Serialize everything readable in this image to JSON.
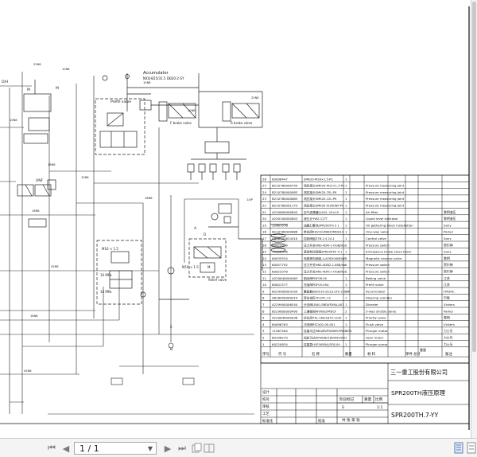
{
  "diagram": {
    "labels": {
      "accumulator": "Accumulator",
      "accumulator_code": "NXQ-B25/31.5",
      "valve_code": "DB20-2 GY",
      "prefill_valve": "Prefill valve",
      "relief_valve": "Relief valve",
      "m16": "M16 × 1.5",
      "m16b": "M16 × 1.5",
      "pressure_a": "10 MPa",
      "pressure_b": "10 MPa",
      "marker_e": "E",
      "marker_b": "B",
      "marker_a": "A"
    },
    "parts_table": {
      "rows": [
        {
          "no": "26",
          "code": "60096447",
          "spec": "SMK20-M16×1.5-PC",
          "qty": "1",
          "name": "",
          "maker": ""
        },
        {
          "no": "25",
          "code": "B210780000749",
          "spec": "测压接头SMK20-M12×1.5-PC",
          "qty": "1",
          "name": "Pressure measuring joint",
          "maker": ""
        },
        {
          "no": "24",
          "code": "B210780000083",
          "spec": "测压接头SMK20-7SL-PK",
          "qty": "1",
          "name": "Pressure measuring joint",
          "maker": ""
        },
        {
          "no": "23",
          "code": "B210780000885",
          "spec": "测压接头SMK20-12L-PK",
          "qty": "1",
          "name": "Pressure measuring joint",
          "maker": ""
        },
        {
          "no": "22",
          "code": "B210780001175",
          "spec": "测压接头SMK20-9/16UNF-PC",
          "qty": "1",
          "name": "Pressure measuring joint",
          "maker": ""
        },
        {
          "no": "21",
          "code": "A220800000845",
          "spec": "空气滤清器QUQ2.-10×10",
          "qty": "1",
          "name": "Air filter",
          "maker": "黎明液压"
        },
        {
          "no": "20",
          "code": "A250100000843",
          "spec": "液位计YWZ-127T",
          "qty": "1",
          "name": "Liquid level indicator",
          "maker": "黎明液压"
        },
        {
          "no": "19",
          "code": "12967576",
          "spec": "油路汇集块SPR200TH 3 1",
          "qty": "1",
          "name": "Oil gathering block installation",
          "maker": "Sany"
        },
        {
          "no": "18",
          "code": "B210780000888",
          "spec": "单向阀RHV10LMEDOMDA1C",
          "qty": "1",
          "name": "One-way valve",
          "maker": "Parker"
        },
        {
          "no": "17",
          "code": "A810101624410",
          "spec": "控制阀组Z7B-2.4 24-1",
          "qty": "1",
          "name": "Control valve",
          "maker": "Sany"
        },
        {
          "no": "16",
          "code": "60022019",
          "spec": "压力开关HNS-4DN-1-OGB/Hor",
          "qty": "1",
          "name": "Pressure switch",
          "maker": "贺尔神"
        },
        {
          "no": "15",
          "code": "10068646",
          "spec": "紧急制动阀组SPR200TH 4-1",
          "qty": "1",
          "name": "Emergency brake valve block",
          "maker": "Sany"
        },
        {
          "no": "14",
          "code": "60035534",
          "spec": "电磁换向阀组-4-AOB10ANDWE",
          "qty": "1",
          "name": "Magnetic reverse valve",
          "maker": "黎明"
        },
        {
          "no": "13",
          "code": "60057792",
          "spec": "压力开关HNS-4DN2-1-8SB/hor",
          "qty": "1",
          "name": "Pressure switch",
          "maker": "贺尔神"
        },
        {
          "no": "12",
          "code": "60022078",
          "spec": "压力开关HNS-4DN-1-OGB/Hor",
          "qty": "1",
          "name": "Pressure switch",
          "maker": "贺尔神"
        },
        {
          "no": "11",
          "code": "A220640000463",
          "spec": "制动阀PDF06-00",
          "qty": "1",
          "name": "Baking valve",
          "maker": "江苏"
        },
        {
          "no": "10",
          "code": "60001577",
          "spec": "充液阀PDF05-00A",
          "qty": "1",
          "name": "Prefill valve",
          "maker": "江苏"
        },
        {
          "no": "9",
          "code": "B229900003339",
          "spec": "蓄能器SBO210-2E1/112U-210AK",
          "qty": "1",
          "name": "Accumulator",
          "maker": "HYDAC"
        },
        {
          "no": "8",
          "code": "A818050000019",
          "spec": "转向油缸LTL25C.13",
          "qty": "1",
          "name": "Steering cylinder",
          "maker": "中联"
        },
        {
          "no": "7",
          "code": "A229900006540",
          "spec": "分流阀LB(K)-5BDVR36A-A01",
          "qty": "1",
          "name": "Diverter",
          "maker": "Vickers"
        },
        {
          "no": "6",
          "code": "B229600000490",
          "spec": "三通梭阀WV08LOMDCF",
          "qty": "2",
          "name": "3-way shuttle valve",
          "maker": "Parker"
        },
        {
          "no": "5",
          "code": "A220640000036",
          "spec": "优先阀YXL-160/1870-122E",
          "qty": "1",
          "name": "Priority valve",
          "maker": "黎明"
        },
        {
          "no": "4",
          "code": "60096763",
          "spec": "冲洗阀RTCX02-00-001",
          "qty": "1",
          "name": "Flush valve",
          "maker": "Vickers"
        },
        {
          "no": "3",
          "code": "11567284",
          "spec": "柱塞马达MB4/BVPSKWM-PRE0570",
          "qty": "1",
          "name": "Plunger motor",
          "maker": "力士乐"
        },
        {
          "no": "2",
          "code": "60106270",
          "spec": "齿轮马达AP9A/B2180FAFG0N",
          "qty": "1",
          "name": "Gear motor",
          "maker": "力士乐"
        },
        {
          "no": "1",
          "code": "60220834",
          "spec": "柱塞泵H1P165R/4/2F8-04",
          "qty": "1",
          "name": "Plunger pump",
          "maker": "力士乐"
        }
      ],
      "header": {
        "no": "序号",
        "code": "代    号",
        "spec": "名        称",
        "qty": "数量",
        "material": "材    料",
        "weight": "单件 总计",
        "weight_unit": "重量",
        "remark": "备注"
      }
    },
    "title_block": {
      "company": "三一重工股份有限公司",
      "drawing_title": "SPR200TH液压原理",
      "drawing_no": "SPR200TH.7-YY",
      "stage": "阶段标记",
      "weight": "重量",
      "scale": "比例",
      "stage_mark": "S",
      "scale_val": "1:1",
      "sheets": "共   张   第   张",
      "design": "设计",
      "check": "校对",
      "review": "审核",
      "craft": "工艺",
      "standard": "标准化",
      "approve": "批准"
    }
  },
  "toolbar": {
    "first_page": "⏮",
    "prev_page": "◀",
    "page_value": "1 / 1",
    "next_page": "▶",
    "last_page": "⏭",
    "dropdown_arrow": "▼"
  }
}
